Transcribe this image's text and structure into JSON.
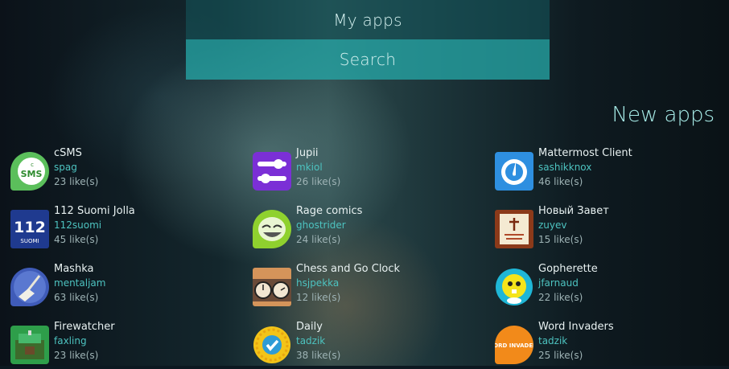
{
  "menu": {
    "my_apps": "My apps",
    "search": "Search"
  },
  "section_title": "New apps",
  "apps": [
    {
      "name": "cSMS",
      "author": "spag",
      "likes": "23 like(s)",
      "icon": "csms-icon"
    },
    {
      "name": "Jupii",
      "author": "mkiol",
      "likes": "26 like(s)",
      "icon": "jupii-icon"
    },
    {
      "name": "Mattermost Client",
      "author": "sashikknox",
      "likes": "46 like(s)",
      "icon": "mattermost-icon"
    },
    {
      "name": "112 Suomi Jolla",
      "author": "112suomi",
      "likes": "45 like(s)",
      "icon": "112-suomi-icon",
      "icon_text": "112",
      "icon_subtext": "SUOMI"
    },
    {
      "name": "Rage comics",
      "author": "ghostrider",
      "likes": "24 like(s)",
      "icon": "rage-comics-icon"
    },
    {
      "name": "Новый Завет",
      "author": "zuyev",
      "likes": "15 like(s)",
      "icon": "bible-icon"
    },
    {
      "name": "Mashka",
      "author": "mentaljam",
      "likes": "63 like(s)",
      "icon": "broom-icon"
    },
    {
      "name": "Chess and Go Clock",
      "author": "hsjpekka",
      "likes": "12 like(s)",
      "icon": "chess-clock-icon"
    },
    {
      "name": "Gopherette",
      "author": "jfarnaud",
      "likes": "22 like(s)",
      "icon": "gopher-icon"
    },
    {
      "name": "Firewatcher",
      "author": "faxling",
      "likes": "23 like(s)",
      "icon": "firewatcher-icon"
    },
    {
      "name": "Daily",
      "author": "tadzik",
      "likes": "38 like(s)",
      "icon": "daily-check-icon"
    },
    {
      "name": "Word Invaders",
      "author": "tadzik",
      "likes": "25 like(s)",
      "icon": "word-invaders-icon",
      "icon_text": "WORD INVADERS"
    }
  ]
}
